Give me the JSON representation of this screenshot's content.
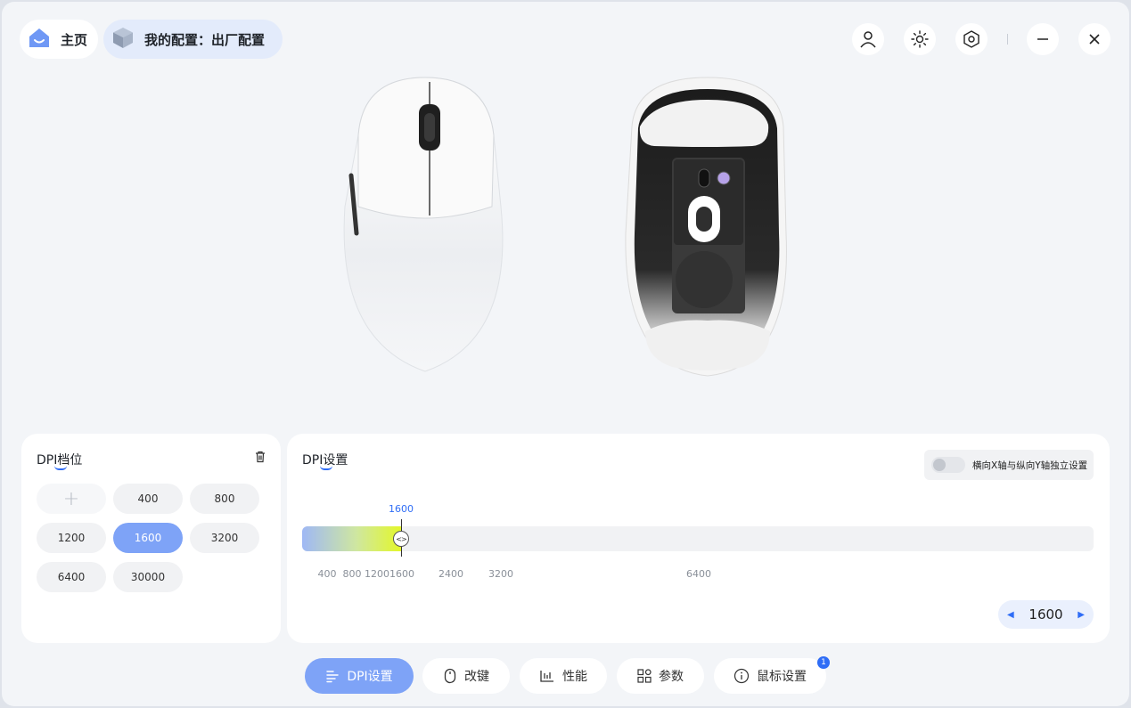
{
  "header": {
    "home_label": "主页",
    "config_label": "我的配置：出厂配置",
    "icons": [
      "user-icon",
      "brightness-icon",
      "settings-icon",
      "minimize-icon",
      "close-icon"
    ]
  },
  "dpi_levels": {
    "title": "DPI档位",
    "add_symbol": "+",
    "values": [
      "400",
      "800",
      "1200",
      "1600",
      "3200",
      "6400",
      "30000"
    ],
    "selected": "1600"
  },
  "dpi_settings": {
    "title": "DPI设置",
    "independent_xy_label": "横向X轴与纵向Y轴独立设置",
    "independent_xy_enabled": false,
    "current_label": "1600",
    "ticks": [
      "400",
      "800",
      "1200",
      "1600",
      "2400",
      "3200",
      "6400"
    ],
    "thumb_glyph": "<>",
    "stepper": {
      "prev": "◀",
      "value": "1600",
      "next": "▶"
    }
  },
  "tabs": [
    {
      "label": "DPI设置",
      "icon": "dpi-list-icon",
      "active": true
    },
    {
      "label": "改键",
      "icon": "mouse-icon",
      "active": false
    },
    {
      "label": "性能",
      "icon": "performance-chart-icon",
      "active": false
    },
    {
      "label": "参数",
      "icon": "grid-params-icon",
      "active": false
    },
    {
      "label": "鼠标设置",
      "icon": "info-icon",
      "active": false,
      "badge": "1"
    }
  ],
  "colors": {
    "accent": "#2f6df6",
    "active_chip": "#7ea3f7",
    "background": "#f3f5f8"
  }
}
